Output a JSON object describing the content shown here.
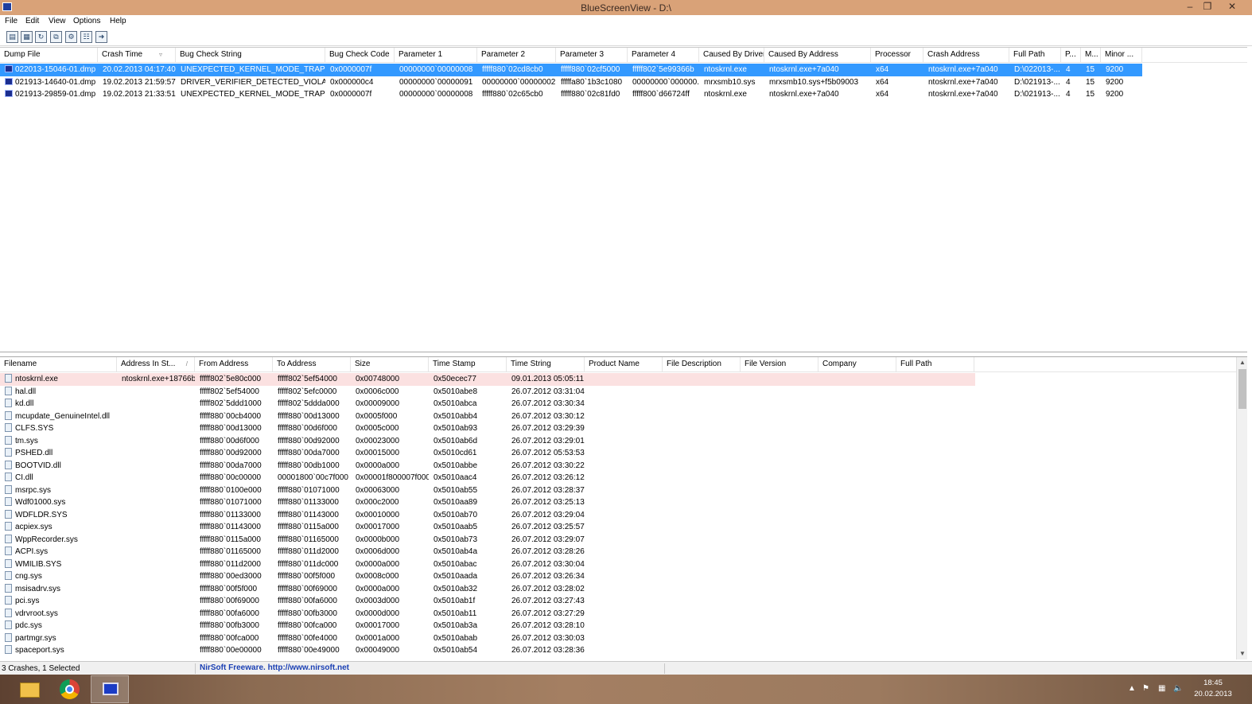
{
  "window": {
    "title": "BlueScreenView  -  D:\\"
  },
  "menu": [
    "File",
    "Edit",
    "View",
    "Options",
    "Help"
  ],
  "toolbar": [
    "properties-icon",
    "save-icon",
    "refresh-icon",
    "copy-icon",
    "options-icon",
    "html-report-icon",
    "exit-icon"
  ],
  "crash_list": {
    "columns": [
      "Dump File",
      "Crash Time",
      "Bug Check String",
      "Bug Check Code",
      "Parameter 1",
      "Parameter 2",
      "Parameter 3",
      "Parameter 4",
      "Caused By Driver",
      "Caused By Address",
      "Processor",
      "Crash Address",
      "Full Path",
      "P...",
      "M...",
      "Minor ..."
    ],
    "rows": [
      [
        "022013-15046-01.dmp",
        "20.02.2013 04:17:40",
        "UNEXPECTED_KERNEL_MODE_TRAP",
        "0x0000007f",
        "00000000`00000008",
        "fffff880`02cd8cb0",
        "fffff880`02cf5000",
        "fffff802`5e99366b",
        "ntoskrnl.exe",
        "ntoskrnl.exe+7a040",
        "x64",
        "ntoskrnl.exe+7a040",
        "D:\\022013-...",
        "4",
        "15",
        "9200"
      ],
      [
        "021913-14640-01.dmp",
        "19.02.2013 21:59:57",
        "DRIVER_VERIFIER_DETECTED_VIOLATION",
        "0x000000c4",
        "00000000`00000091",
        "00000000`00000002",
        "fffffa80`1b3c1080",
        "00000000`000000...",
        "mrxsmb10.sys",
        "mrxsmb10.sys+f5b09003",
        "x64",
        "ntoskrnl.exe+7a040",
        "D:\\021913-...",
        "4",
        "15",
        "9200"
      ],
      [
        "021913-29859-01.dmp",
        "19.02.2013 21:33:51",
        "UNEXPECTED_KERNEL_MODE_TRAP",
        "0x0000007f",
        "00000000`00000008",
        "fffff880`02c65cb0",
        "fffff880`02c81fd0",
        "fffff800`d66724ff",
        "ntoskrnl.exe",
        "ntoskrnl.exe+7a040",
        "x64",
        "ntoskrnl.exe+7a040",
        "D:\\021913-...",
        "4",
        "15",
        "9200"
      ]
    ]
  },
  "module_list": {
    "columns": [
      "Filename",
      "Address In St...",
      "From Address",
      "To Address",
      "Size",
      "Time Stamp",
      "Time String",
      "Product Name",
      "File Description",
      "File Version",
      "Company",
      "Full Path"
    ],
    "rows": [
      [
        "ntoskrnl.exe",
        "ntoskrnl.exe+18766b",
        "fffff802`5e80c000",
        "fffff802`5ef54000",
        "0x00748000",
        "0x50ecec77",
        "09.01.2013 05:05:11"
      ],
      [
        "hal.dll",
        "",
        "fffff802`5ef54000",
        "fffff802`5efc0000",
        "0x0006c000",
        "0x5010abe8",
        "26.07.2012 03:31:04"
      ],
      [
        "kd.dll",
        "",
        "fffff802`5ddd1000",
        "fffff802`5ddda000",
        "0x00009000",
        "0x5010abca",
        "26.07.2012 03:30:34"
      ],
      [
        "mcupdate_GenuineIntel.dll",
        "",
        "fffff880`00cb4000",
        "fffff880`00d13000",
        "0x0005f000",
        "0x5010abb4",
        "26.07.2012 03:30:12"
      ],
      [
        "CLFS.SYS",
        "",
        "fffff880`00d13000",
        "fffff880`00d6f000",
        "0x0005c000",
        "0x5010ab93",
        "26.07.2012 03:29:39"
      ],
      [
        "tm.sys",
        "",
        "fffff880`00d6f000",
        "fffff880`00d92000",
        "0x00023000",
        "0x5010ab6d",
        "26.07.2012 03:29:01"
      ],
      [
        "PSHED.dll",
        "",
        "fffff880`00d92000",
        "fffff880`00da7000",
        "0x00015000",
        "0x5010cd61",
        "26.07.2012 05:53:53"
      ],
      [
        "BOOTVID.dll",
        "",
        "fffff880`00da7000",
        "fffff880`00db1000",
        "0x0000a000",
        "0x5010abbe",
        "26.07.2012 03:30:22"
      ],
      [
        "CI.dll",
        "",
        "fffff880`00c00000",
        "00001800`00c7f000",
        "0x00001f800007f000",
        "0x5010aac4",
        "26.07.2012 03:26:12"
      ],
      [
        "msrpc.sys",
        "",
        "fffff880`0100e000",
        "fffff880`01071000",
        "0x00063000",
        "0x5010ab55",
        "26.07.2012 03:28:37"
      ],
      [
        "Wdf01000.sys",
        "",
        "fffff880`01071000",
        "fffff880`01133000",
        "0x000c2000",
        "0x5010aa89",
        "26.07.2012 03:25:13"
      ],
      [
        "WDFLDR.SYS",
        "",
        "fffff880`01133000",
        "fffff880`01143000",
        "0x00010000",
        "0x5010ab70",
        "26.07.2012 03:29:04"
      ],
      [
        "acpiex.sys",
        "",
        "fffff880`01143000",
        "fffff880`0115a000",
        "0x00017000",
        "0x5010aab5",
        "26.07.2012 03:25:57"
      ],
      [
        "WppRecorder.sys",
        "",
        "fffff880`0115a000",
        "fffff880`01165000",
        "0x0000b000",
        "0x5010ab73",
        "26.07.2012 03:29:07"
      ],
      [
        "ACPI.sys",
        "",
        "fffff880`01165000",
        "fffff880`011d2000",
        "0x0006d000",
        "0x5010ab4a",
        "26.07.2012 03:28:26"
      ],
      [
        "WMILIB.SYS",
        "",
        "fffff880`011d2000",
        "fffff880`011dc000",
        "0x0000a000",
        "0x5010abac",
        "26.07.2012 03:30:04"
      ],
      [
        "cng.sys",
        "",
        "fffff880`00ed3000",
        "fffff880`00f5f000",
        "0x0008c000",
        "0x5010aada",
        "26.07.2012 03:26:34"
      ],
      [
        "msisadrv.sys",
        "",
        "fffff880`00f5f000",
        "fffff880`00f69000",
        "0x0000a000",
        "0x5010ab32",
        "26.07.2012 03:28:02"
      ],
      [
        "pci.sys",
        "",
        "fffff880`00f69000",
        "fffff880`00fa6000",
        "0x0003d000",
        "0x5010ab1f",
        "26.07.2012 03:27:43"
      ],
      [
        "vdrvroot.sys",
        "",
        "fffff880`00fa6000",
        "fffff880`00fb3000",
        "0x0000d000",
        "0x5010ab11",
        "26.07.2012 03:27:29"
      ],
      [
        "pdc.sys",
        "",
        "fffff880`00fb3000",
        "fffff880`00fca000",
        "0x00017000",
        "0x5010ab3a",
        "26.07.2012 03:28:10"
      ],
      [
        "partmgr.sys",
        "",
        "fffff880`00fca000",
        "fffff880`00fe4000",
        "0x0001a000",
        "0x5010abab",
        "26.07.2012 03:30:03"
      ],
      [
        "spaceport.sys",
        "",
        "fffff880`00e00000",
        "fffff880`00e49000",
        "0x00049000",
        "0x5010ab54",
        "26.07.2012 03:28:36"
      ]
    ]
  },
  "status": {
    "summary": "3 Crashes, 1 Selected",
    "credit": "NirSoft Freeware.  http://www.nirsoft.net"
  },
  "taskbar": {
    "time": "18:45",
    "date": "20.02.2013"
  },
  "colors": {
    "titlebar": "#d9a278",
    "selection": "#3399ff",
    "highlight_row": "#fbe1e1",
    "link": "#1a3fb3"
  }
}
